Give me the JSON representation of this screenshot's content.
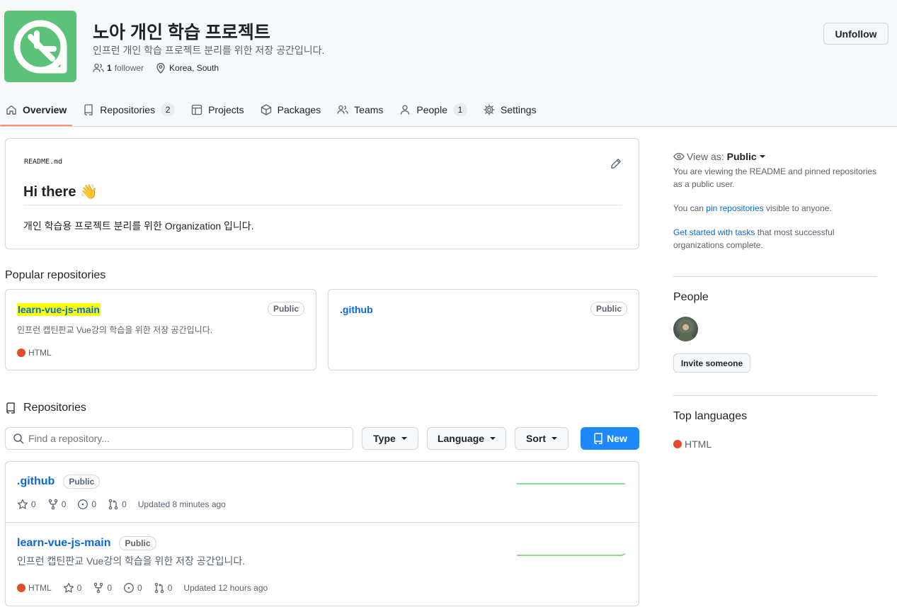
{
  "org": {
    "name": "노아 개인 학습 프로젝트",
    "description": "인프런 개인 학습 프로젝트 분리를 위한 저장 공간입니다.",
    "followers_count": "1",
    "followers_label": "follower",
    "location": "Korea, South",
    "unfollow_label": "Unfollow"
  },
  "tabs": [
    {
      "label": "Overview",
      "icon": "home-icon",
      "active": true
    },
    {
      "label": "Repositories",
      "icon": "repo-icon",
      "count": "2"
    },
    {
      "label": "Projects",
      "icon": "table-icon"
    },
    {
      "label": "Packages",
      "icon": "package-icon"
    },
    {
      "label": "Teams",
      "icon": "people-icon"
    },
    {
      "label": "People",
      "icon": "person-icon",
      "count": "1"
    },
    {
      "label": "Settings",
      "icon": "gear-icon"
    }
  ],
  "readme": {
    "filename": "README.md",
    "heading": "Hi there 👋",
    "body": "개인 학습용 프로젝트 분리를 위한 Organization 입니다."
  },
  "popular": {
    "title": "Popular repositories",
    "items": [
      {
        "name": "learn-vue-js-main",
        "visibility": "Public",
        "description": "인프런 캡틴판교 Vue강의 학습을 위한 저장 공간입니다.",
        "language": "HTML",
        "language_color": "#e34c26",
        "highlighted": true
      },
      {
        "name": ".github",
        "visibility": "Public"
      }
    ]
  },
  "repositories": {
    "title": "Repositories",
    "search_placeholder": "Find a repository...",
    "type_label": "Type",
    "language_label": "Language",
    "sort_label": "Sort",
    "new_label": "New",
    "items": [
      {
        "name": ".github",
        "visibility": "Public",
        "stars": "0",
        "forks": "0",
        "issues": "0",
        "pulls": "0",
        "updated": "Updated 8 minutes ago"
      },
      {
        "name": "learn-vue-js-main",
        "visibility": "Public",
        "description": "인프런 캡틴판교 Vue강의 학습을 위한 저장 공간입니다.",
        "language": "HTML",
        "stars": "0",
        "forks": "0",
        "issues": "0",
        "pulls": "0",
        "updated": "Updated 12 hours ago"
      }
    ]
  },
  "sidebar": {
    "view_as_label": "View as:",
    "view_as_value": "Public",
    "view_as_desc": "You are viewing the README and pinned repositories as a public user.",
    "pin_prefix": "You can ",
    "pin_link": "pin repositories",
    "pin_suffix": " visible to anyone.",
    "tasks_link": "Get started with tasks",
    "tasks_suffix": " that most successful organizations complete.",
    "people_title": "People",
    "invite_label": "Invite someone",
    "top_languages_title": "Top languages",
    "top_language": "HTML"
  },
  "colors": {
    "accent_link": "#0969da",
    "brand_green": "#5cc27a",
    "primary_button": "#1f88ff",
    "html_language": "#e34c26",
    "tab_underline": "#fd8c73",
    "highlight": "#f8ff00"
  }
}
